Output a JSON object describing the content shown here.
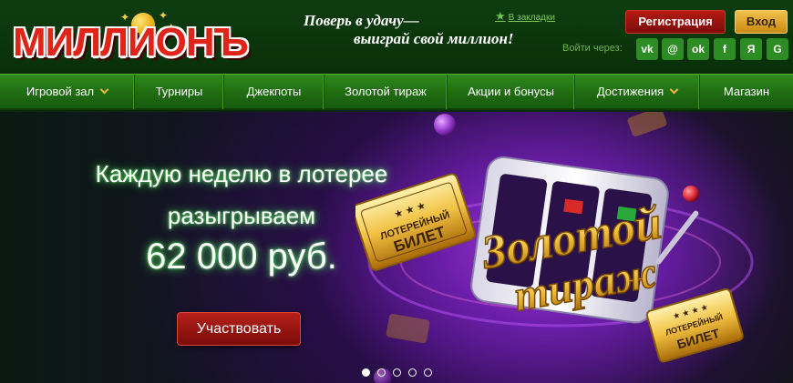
{
  "brand": {
    "logo_text": "МИЛЛИОНЪ"
  },
  "header": {
    "slogan_line1": "Поверь в удачу—",
    "slogan_line2": "выиграй свой миллион!",
    "bookmark_label": "В закладки",
    "register_label": "Регистрация",
    "login_label": "Вход",
    "login_via_label": "Войти через:",
    "social": [
      {
        "label": "vk",
        "icon": "vk-icon"
      },
      {
        "label": "@",
        "icon": "mail-icon"
      },
      {
        "label": "ok",
        "icon": "odnoklassniki-icon"
      },
      {
        "label": "f",
        "icon": "facebook-icon"
      },
      {
        "label": "Я",
        "icon": "yandex-icon"
      },
      {
        "label": "G",
        "icon": "google-icon"
      }
    ]
  },
  "nav": {
    "items": [
      {
        "label": "Игровой зал",
        "has_dropdown": true
      },
      {
        "label": "Турниры",
        "has_dropdown": false
      },
      {
        "label": "Джекпоты",
        "has_dropdown": false
      },
      {
        "label": "Золотой тираж",
        "has_dropdown": false
      },
      {
        "label": "Акции и бонусы",
        "has_dropdown": false
      },
      {
        "label": "Достижения",
        "has_dropdown": true
      },
      {
        "label": "Магазин",
        "has_dropdown": false
      }
    ]
  },
  "hero": {
    "line1": "Каждую неделю в лотерее",
    "line2": "разыгрываем",
    "line3": "62 000 руб.",
    "cta_label": "Участвовать",
    "art_title": "Золотой тираж",
    "ticket_text_a": "ЛОТЕРЕЙНЫЙ БИЛЕТ",
    "ticket_text_b": "ЛОТЕРЕЙНЫЙ БИЛЕТ",
    "slides_count": 5,
    "active_slide": 1
  },
  "colors": {
    "header_bg": "#0b3a0e",
    "nav_green": "#226f14",
    "register_red": "#9e1510",
    "login_gold": "#e0a830",
    "hero_purple": "#6a1ea8",
    "glow_green": "#50ff5a"
  }
}
